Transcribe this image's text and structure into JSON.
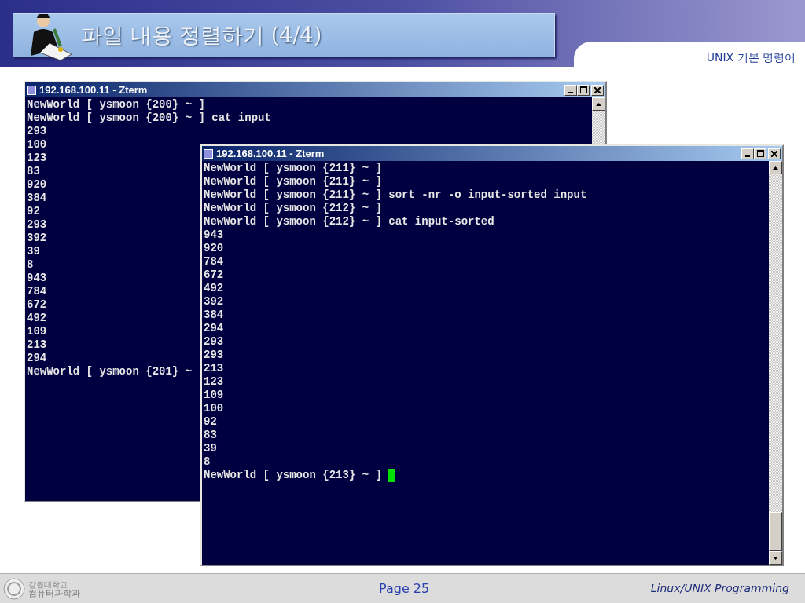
{
  "slide": {
    "title": "파일 내용 정렬하기 (4/4)",
    "section": "UNIX 기본 명령어"
  },
  "windows": [
    {
      "title": "192.168.100.11 - Zterm",
      "cursor": false,
      "lines": [
        "NewWorld [ ysmoon {200} ~ ]",
        "NewWorld [ ysmoon {200} ~ ] cat input",
        "293",
        "100",
        "123",
        "83",
        "920",
        "384",
        "92",
        "293",
        "392",
        "39",
        "8",
        "943",
        "784",
        "672",
        "492",
        "109",
        "213",
        "294",
        "NewWorld [ ysmoon {201} ~"
      ]
    },
    {
      "title": "192.168.100.11 - Zterm",
      "cursor": true,
      "lines": [
        "NewWorld [ ysmoon {211} ~ ]",
        "NewWorld [ ysmoon {211} ~ ]",
        "NewWorld [ ysmoon {211} ~ ] sort -nr -o input-sorted input",
        "NewWorld [ ysmoon {212} ~ ]",
        "NewWorld [ ysmoon {212} ~ ] cat input-sorted",
        "943",
        "920",
        "784",
        "672",
        "492",
        "392",
        "384",
        "294",
        "293",
        "293",
        "213",
        "123",
        "109",
        "100",
        "92",
        "83",
        "39",
        "8",
        "NewWorld [ ysmoon {213} ~ ]"
      ]
    }
  ],
  "footer": {
    "org_line_1": "강원대학교",
    "org_line_2": "컴퓨터과학과",
    "page": "Page 25",
    "course": "Linux/UNIX Programming"
  }
}
